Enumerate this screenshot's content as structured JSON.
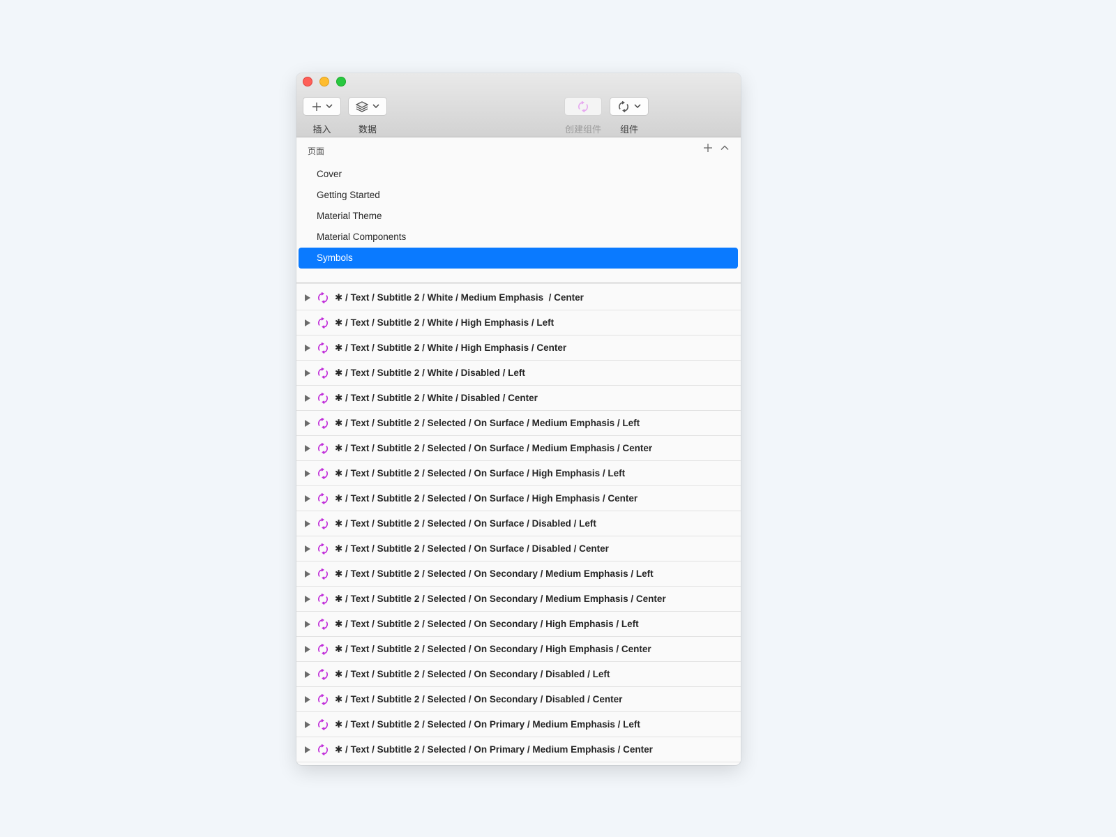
{
  "toolbar": {
    "insert_label": "插入",
    "data_label": "数据",
    "create_symbol_label": "创建组件",
    "symbols_label": "组件"
  },
  "pages": {
    "header": "页面",
    "items": [
      {
        "label": "Cover",
        "selected": false
      },
      {
        "label": "Getting Started",
        "selected": false
      },
      {
        "label": "Material Theme",
        "selected": false
      },
      {
        "label": "Material Components",
        "selected": false
      },
      {
        "label": "Symbols",
        "selected": true
      }
    ]
  },
  "layers": [
    "✱ / Text / Subtitle 2 / White / Medium Emphasis  / Center",
    "✱ / Text / Subtitle 2 / White / High Emphasis / Left",
    "✱ / Text / Subtitle 2 / White / High Emphasis / Center",
    "✱ / Text / Subtitle 2 / White / Disabled / Left",
    "✱ / Text / Subtitle 2 / White / Disabled / Center",
    "✱ / Text / Subtitle 2 / Selected / On Surface / Medium Emphasis / Left",
    "✱ / Text / Subtitle 2 / Selected / On Surface / Medium Emphasis / Center",
    "✱ / Text / Subtitle 2 / Selected / On Surface / High Emphasis / Left",
    "✱ / Text / Subtitle 2 / Selected / On Surface / High Emphasis / Center",
    "✱ / Text / Subtitle 2 / Selected / On Surface / Disabled / Left",
    "✱ / Text / Subtitle 2 / Selected / On Surface / Disabled / Center",
    "✱ / Text / Subtitle 2 / Selected / On Secondary / Medium Emphasis / Left",
    "✱ / Text / Subtitle 2 / Selected / On Secondary / Medium Emphasis / Center",
    "✱ / Text / Subtitle 2 / Selected / On Secondary / High Emphasis / Left",
    "✱ / Text / Subtitle 2 / Selected / On Secondary / High Emphasis / Center",
    "✱ / Text / Subtitle 2 / Selected / On Secondary / Disabled / Left",
    "✱ / Text / Subtitle 2 / Selected / On Secondary / Disabled / Center",
    "✱ / Text / Subtitle 2 / Selected / On Primary / Medium Emphasis / Left",
    "✱ / Text / Subtitle 2 / Selected / On Primary / Medium Emphasis / Center"
  ],
  "colors": {
    "selection": "#0a7aff",
    "symbol_icon": "#c02bd9"
  }
}
